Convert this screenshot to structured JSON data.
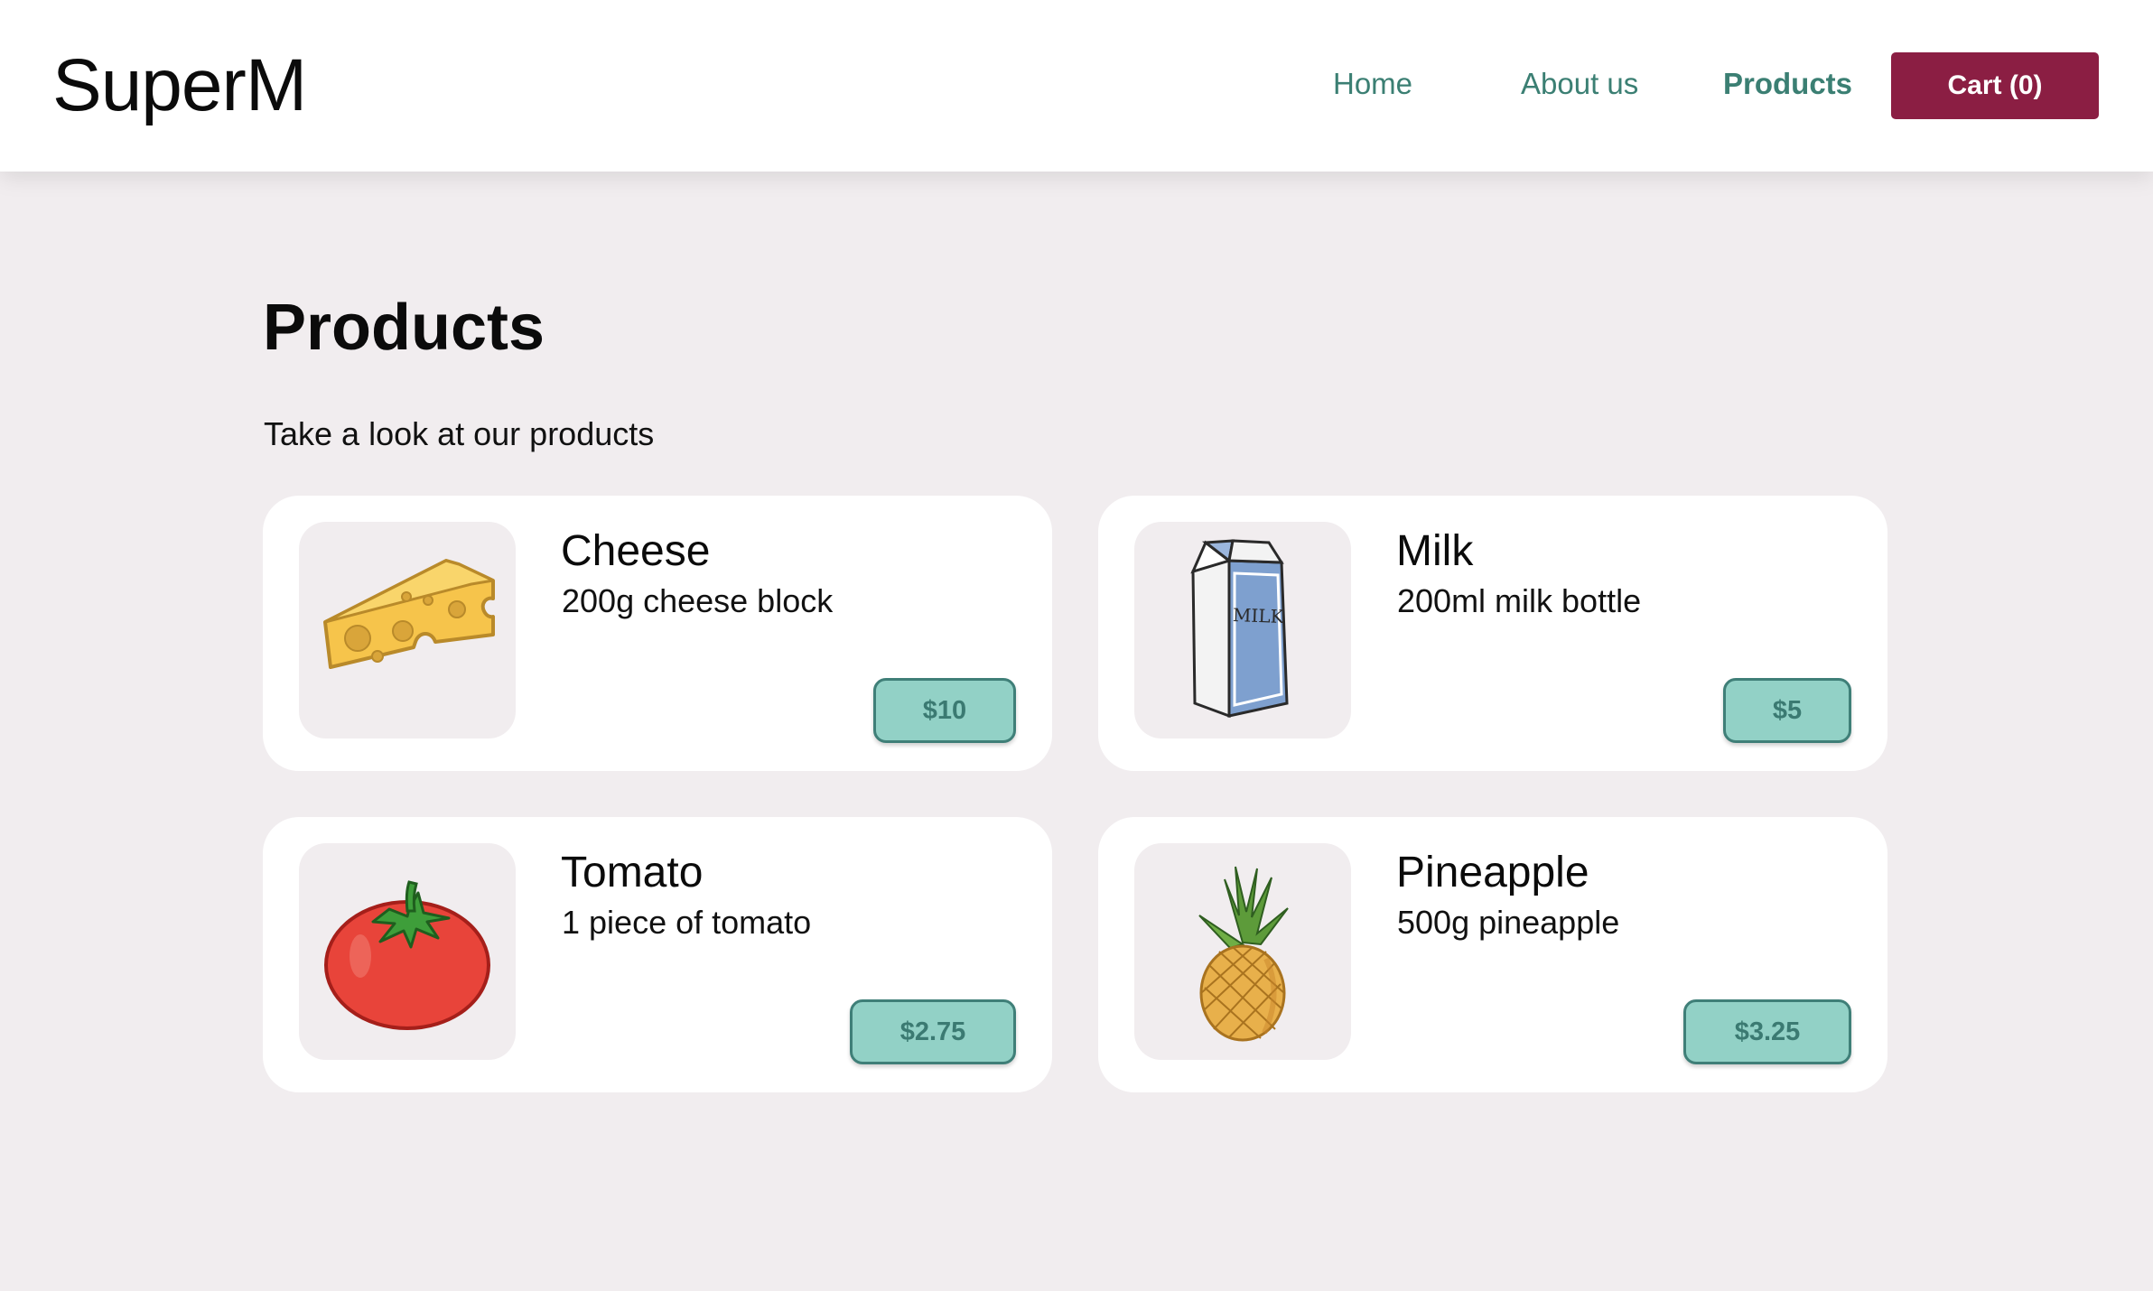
{
  "header": {
    "brand": "SuperM",
    "nav": {
      "home": "Home",
      "about": "About us",
      "products": "Products"
    },
    "cart_label": "Cart (0)"
  },
  "main": {
    "title": "Products",
    "subtitle": "Take a look at our products",
    "products": [
      {
        "name": "Cheese",
        "description": "200g cheese block",
        "price": "$10",
        "icon": "cheese-icon"
      },
      {
        "name": "Milk",
        "description": "200ml milk bottle",
        "price": "$5",
        "icon": "milk-carton-icon"
      },
      {
        "name": "Tomato",
        "description": "1 piece of tomato",
        "price": "$2.75",
        "icon": "tomato-icon"
      },
      {
        "name": "Pineapple",
        "description": "500g pineapple",
        "price": "$3.25",
        "icon": "pineapple-icon"
      }
    ]
  },
  "colors": {
    "accent_green": "#3b7f73",
    "cart_button": "#8b1e43",
    "price_button": "#92d1c6",
    "background": "#f1edef"
  }
}
